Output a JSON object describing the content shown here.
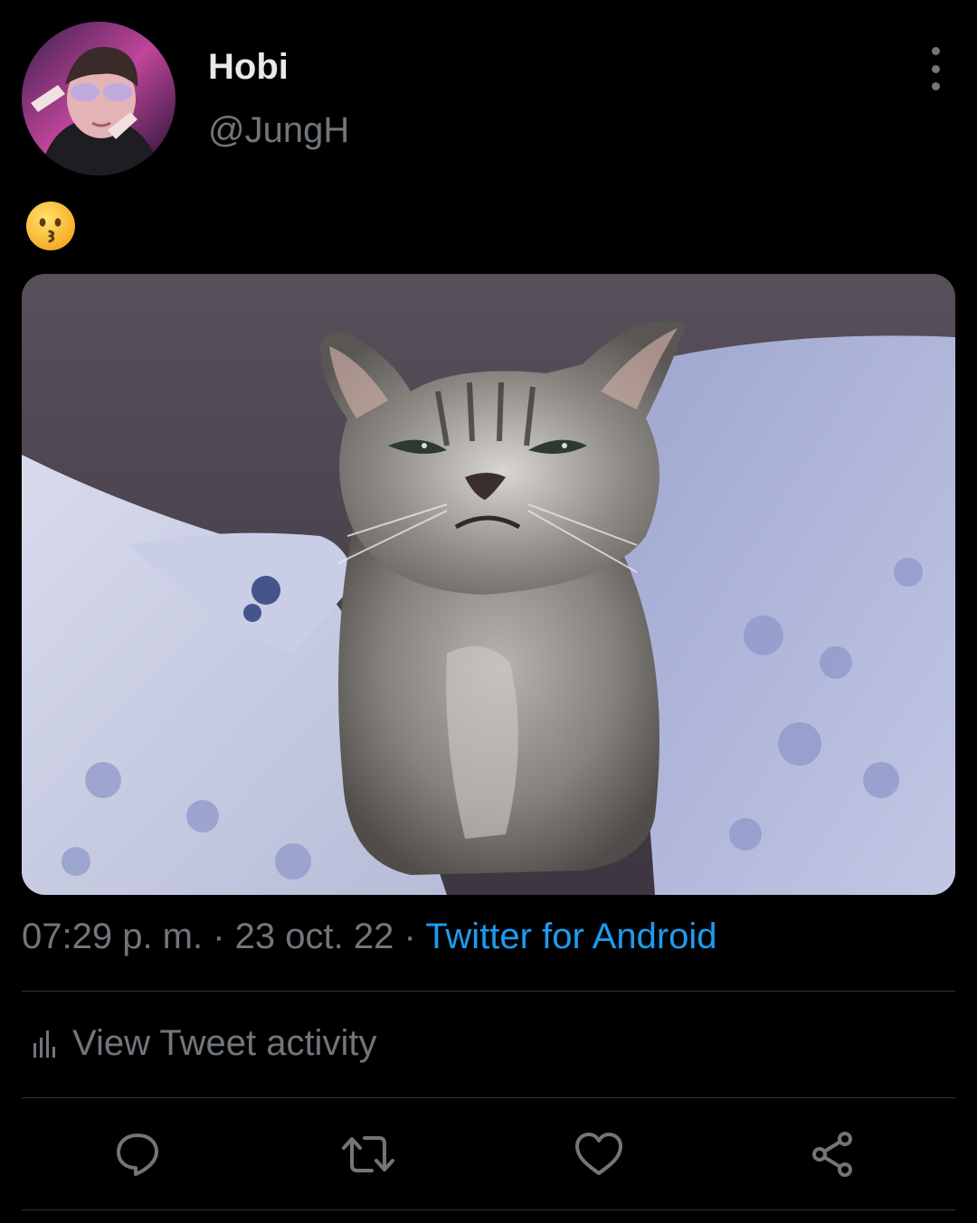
{
  "author": {
    "display_name": "Hobi",
    "handle": "@JungH",
    "avatar_icon": "avatar-photo"
  },
  "tweet": {
    "text_emoji": "kissing-face-emoji",
    "media_icon": "kitten-photo",
    "time": "07:29 p. m.",
    "separator": " · ",
    "date": "23 oct. 22",
    "source": "Twitter for Android"
  },
  "activity": {
    "label": "View Tweet activity",
    "icon": "bar-chart-icon"
  },
  "actions": {
    "reply_icon": "reply-icon",
    "retweet_icon": "retweet-icon",
    "like_icon": "heart-icon",
    "share_icon": "share-icon"
  },
  "colors": {
    "background": "#000000",
    "primary_text": "#e7e9ea",
    "secondary_text": "#71767b",
    "link": "#1d9bf0",
    "divider": "#2f3336"
  }
}
